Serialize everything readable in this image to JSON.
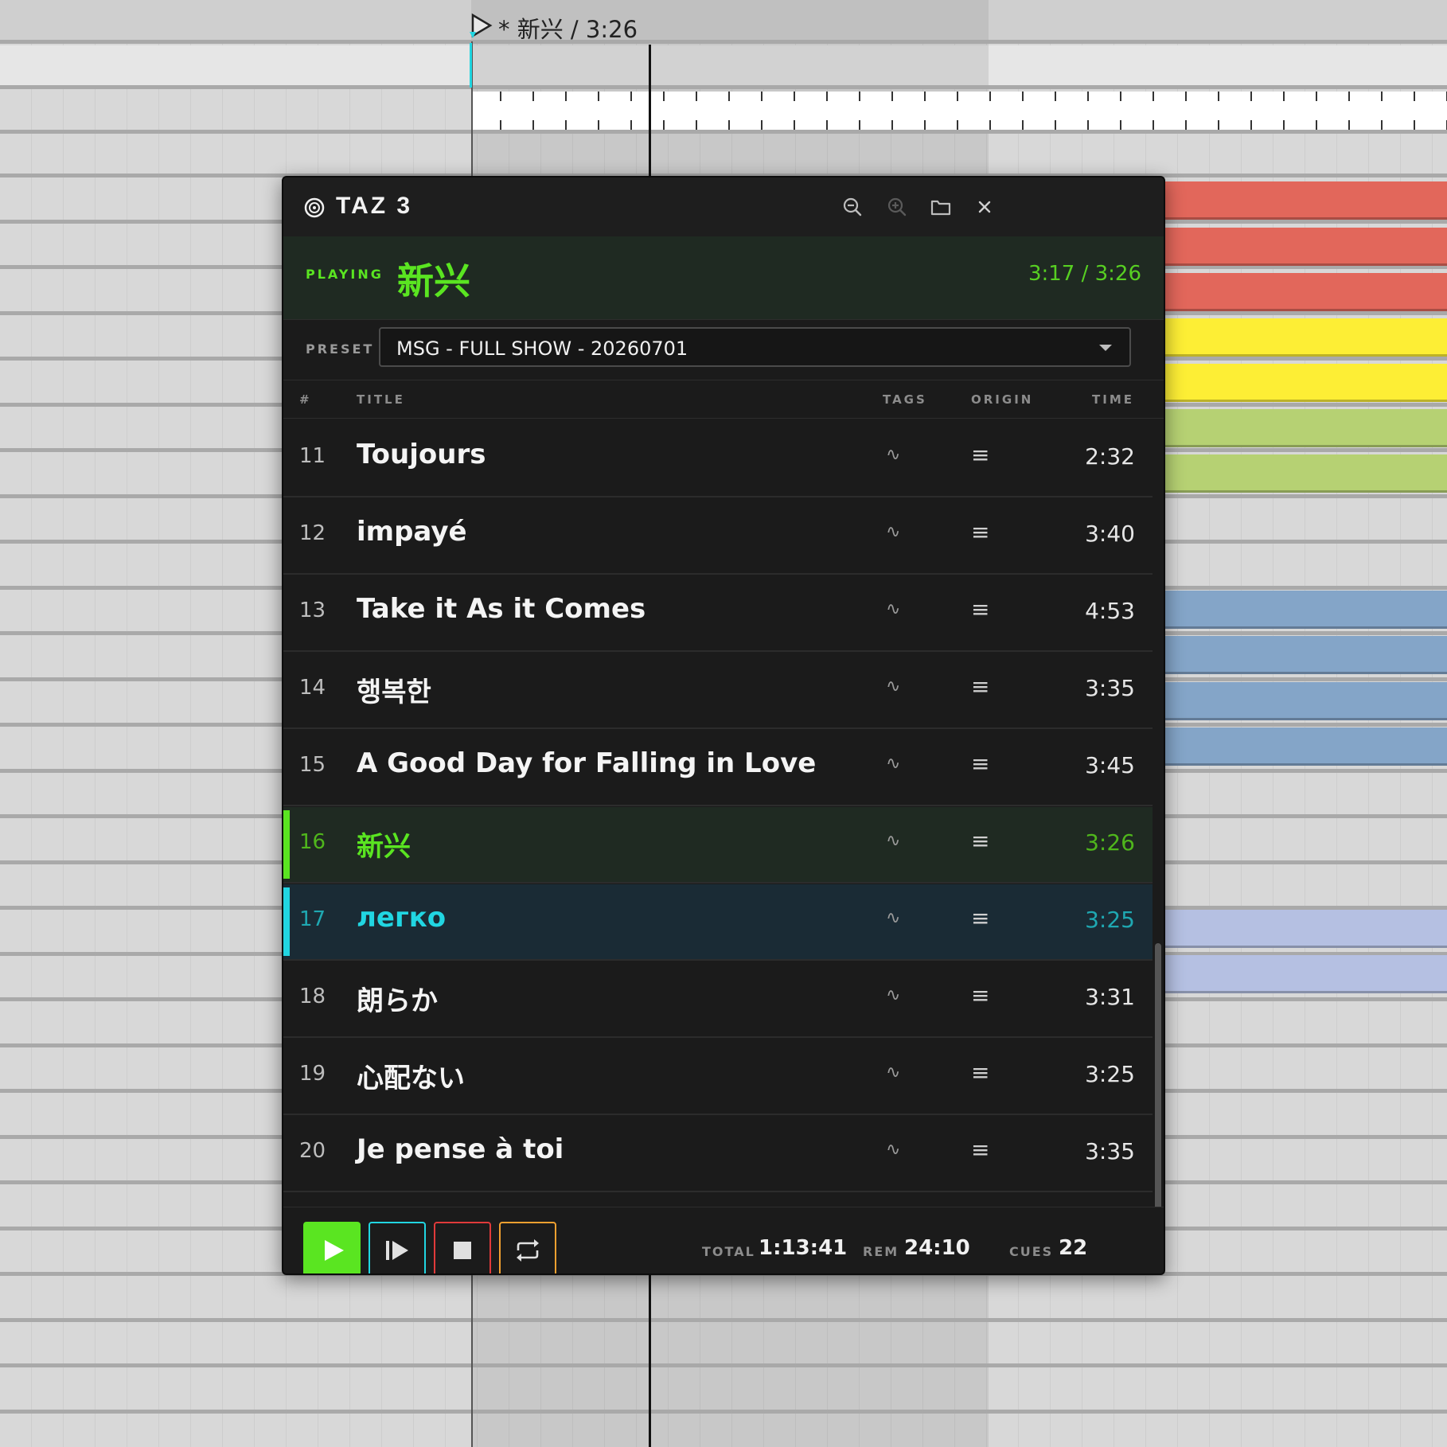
{
  "daw": {
    "marker_label": "* 新兴 / 3:26",
    "clip_colors": {
      "red": "#e2675b",
      "yellow": "#fdee35",
      "green": "#b6d173",
      "blue": "#84a5c8",
      "lavender": "#b5c0e2"
    }
  },
  "app": {
    "title": "TAZ 3",
    "toolbar": {
      "zoom_out_icon": "zoom-out-icon",
      "zoom_in_icon": "zoom-in-icon",
      "folder_icon": "folder-icon",
      "close_icon": "close-icon"
    }
  },
  "now_playing": {
    "label": "PLAYING",
    "title": "新兴",
    "time": "3:17 / 3:26"
  },
  "preset": {
    "label": "PRESET",
    "value": "MSG - FULL SHOW - 20260701"
  },
  "columns": {
    "num": "#",
    "title": "TITLE",
    "tags": "TAGS",
    "origin": "ORIGIN",
    "time": "TIME"
  },
  "rows": [
    {
      "num": "11",
      "title": "Toujours",
      "tag": "∿",
      "origin": "≡",
      "time": "2:32",
      "state": ""
    },
    {
      "num": "12",
      "title": "impayé",
      "tag": "∿",
      "origin": "≡",
      "time": "3:40",
      "state": ""
    },
    {
      "num": "13",
      "title": "Take it As it Comes",
      "tag": "∿",
      "origin": "≡",
      "time": "4:53",
      "state": ""
    },
    {
      "num": "14",
      "title": "행복한",
      "tag": "∿",
      "origin": "≡",
      "time": "3:35",
      "state": ""
    },
    {
      "num": "15",
      "title": "A Good Day for Falling in Love",
      "tag": "∿",
      "origin": "≡",
      "time": "3:45",
      "state": ""
    },
    {
      "num": "16",
      "title": "新兴",
      "tag": "∿",
      "origin": "≡",
      "time": "3:26",
      "state": "playing"
    },
    {
      "num": "17",
      "title": "легко",
      "tag": "∿",
      "origin": "≡",
      "time": "3:25",
      "state": "next"
    },
    {
      "num": "18",
      "title": "朗らか",
      "tag": "∿",
      "origin": "≡",
      "time": "3:31",
      "state": ""
    },
    {
      "num": "19",
      "title": "心配ない",
      "tag": "∿",
      "origin": "≡",
      "time": "3:25",
      "state": ""
    },
    {
      "num": "20",
      "title": "Je pense à toi",
      "tag": "∿",
      "origin": "≡",
      "time": "3:35",
      "state": ""
    }
  ],
  "transport": {
    "play_icon": "play-icon",
    "play_next_icon": "play-next-icon",
    "stop_icon": "stop-icon",
    "loop_icon": "loop-icon",
    "total_label": "TOTAL",
    "total_value": "1:13:41",
    "rem_label": "REM",
    "rem_value": "24:10",
    "cues_label": "CUES",
    "cues_value": "22"
  },
  "colors": {
    "playing": "#5ae521",
    "next": "#21d6e2",
    "stop": "#e03a3a",
    "loop": "#f0a030"
  }
}
